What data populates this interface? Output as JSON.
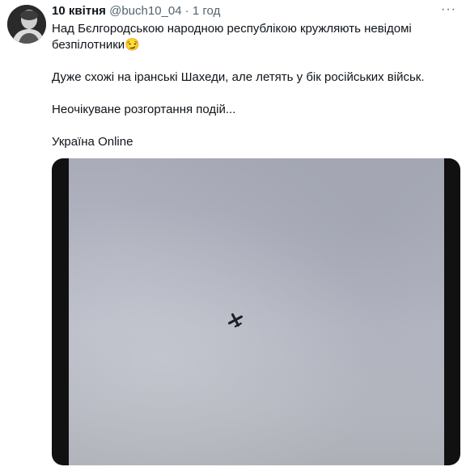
{
  "tweet": {
    "author": "10 квітня",
    "handle": "@buch10_04",
    "separator": "·",
    "time": "1 год",
    "more_icon": "more-horizontal-icon",
    "lines": [
      "Над Бєлгородською народною республікою кружляють невідомі безпілотники",
      "Дуже схожі на іранські Шахеди, але летять у бік російських військ.",
      "Неочікуване розгортання подій...",
      "Україна Online"
    ],
    "emoji": "😏"
  },
  "media": {
    "type": "video-frame",
    "subject_icon": "drone-icon"
  },
  "colors": {
    "text": "#0f1419",
    "meta": "#536471",
    "video_bg": "#b2b5c1"
  }
}
